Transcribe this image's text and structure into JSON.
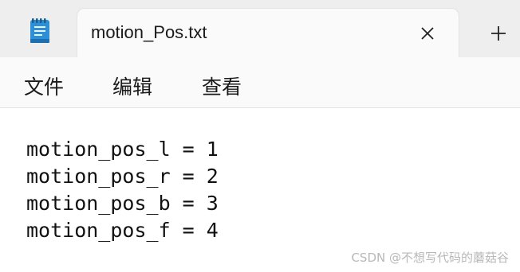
{
  "window": {
    "app_icon": "notepad-icon",
    "tab_title": "motion_Pos.txt",
    "close_icon": "close-icon",
    "new_tab_icon": "plus-icon"
  },
  "menu": {
    "items": [
      "文件",
      "编辑",
      "查看"
    ]
  },
  "editor": {
    "lines": [
      "motion_pos_l = 1",
      "motion_pos_r = 2",
      "motion_pos_b = 3",
      "motion_pos_f = 4"
    ]
  },
  "watermark": "CSDN @不想写代码的蘑菇谷",
  "colors": {
    "titlebar_bg": "#eeeeee",
    "tab_bg": "#fafafa",
    "editor_bg": "#ffffff",
    "icon_accent": "#2d8fd5"
  }
}
